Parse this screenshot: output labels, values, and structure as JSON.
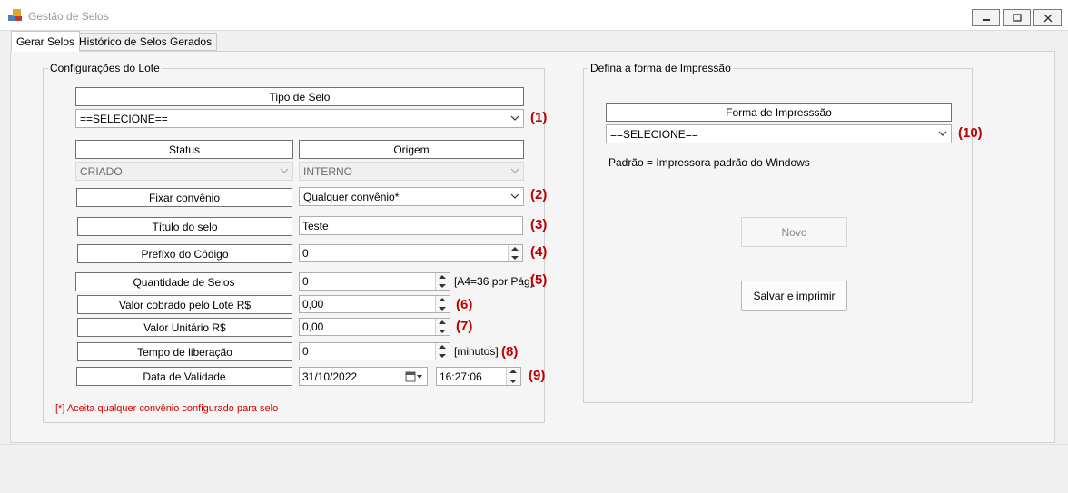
{
  "window": {
    "title": "Gestão de Selos",
    "minimize_icon": "minimize-icon",
    "restore_icon": "restore-icon",
    "close_icon": "close-icon"
  },
  "tabs": [
    {
      "label": "Gerar Selos",
      "active": true
    },
    {
      "label": "Histórico de Selos Gerados",
      "active": false
    }
  ],
  "lote": {
    "group_title": "Configurações do Lote",
    "tipo_selo_label": "Tipo de Selo",
    "tipo_selo_value": "==SELECIONE==",
    "status_label": "Status",
    "status_value": "CRIADO",
    "origem_label": "Origem",
    "origem_value": "INTERNO",
    "fixar_convenio_label": "Fixar convênio",
    "fixar_convenio_value": "Qualquer convênio*",
    "titulo_label": "Título do selo",
    "titulo_value": "Teste",
    "prefixo_label": "Prefíxo do Código",
    "prefixo_value": "0",
    "quantidade_label": "Quantidade de Selos",
    "quantidade_value": "0",
    "quantidade_hint": "[A4=36 por Pág]",
    "valor_lote_label": "Valor cobrado pelo Lote R$",
    "valor_lote_value": "0,00",
    "valor_unitario_label": "Valor Unitário R$",
    "valor_unitario_value": "0,00",
    "tempo_label": "Tempo de liberação",
    "tempo_value": "0",
    "tempo_hint": "[minutos]",
    "validade_label": "Data de Validade",
    "validade_date": "31/10/2022",
    "validade_time": "16:27:06",
    "note": "[*] Aceita qualquer convênio configurado para selo"
  },
  "markers": {
    "m1": "(1)",
    "m2": "(2)",
    "m3": "(3)",
    "m4": "(4)",
    "m5": "(5)",
    "m6": "(6)",
    "m7": "(7)",
    "m8": "(8)",
    "m9": "(9)",
    "m10": "(10)"
  },
  "impressao": {
    "group_title": "Defina a forma de Impressão",
    "forma_label": "Forma de Impresssão",
    "forma_value": "==SELECIONE==",
    "padrao_text": "Padrão = Impressora padrão do Windows",
    "novo_button": "Novo",
    "salvar_button": "Salvar e imprimir"
  },
  "colors": {
    "marker_red": "#c00000",
    "note_red": "#d10000"
  }
}
